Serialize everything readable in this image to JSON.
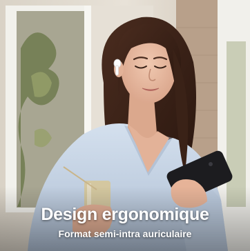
{
  "product_image": {
    "title": "Design ergonomique",
    "subtitle": "Format semi-intra auriculaire"
  },
  "colors": {
    "background_wall": "#e3ddd3",
    "brick": "#b49a82",
    "window_frame": "#f4f3ef",
    "shirt": "#c9d7e8",
    "hair": "#3a2217",
    "skin": "#e7b9a0",
    "phone": "#1c1c1f",
    "caption_text": "#ffffff"
  }
}
